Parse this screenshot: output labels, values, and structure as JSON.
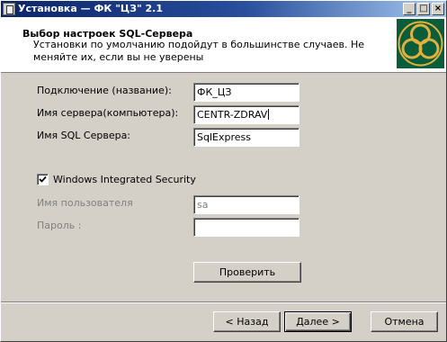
{
  "window": {
    "title": "Установка — ФК \"ЦЗ\" 2.1"
  },
  "titlebar_buttons": {
    "minimize": "_",
    "maximize": "□",
    "close": "×"
  },
  "header": {
    "title": "Выбор настроек SQL-Сервера",
    "subtitle": "Установки по умолчанию подойдут в большинстве случаев. Не меняйте их, если вы не уверены"
  },
  "form": {
    "connection_label": "Подключение (название):",
    "connection_value": "ФК_ЦЗ",
    "server_label": "Имя сервера(компьютера):",
    "server_value": "CENTR-ZDRAV",
    "sql_label": "Имя SQL Сервера:",
    "sql_value": "SqlExpress",
    "integrated_label": "Windows Integrated Security",
    "integrated_checked": true,
    "user_label": "Имя пользователя",
    "user_value": "sa",
    "password_label": "Пароль :",
    "password_value": ""
  },
  "buttons": {
    "check": "Проверить",
    "back": "< Назад",
    "next": "Далее >",
    "cancel": "Отмена"
  },
  "colors": {
    "titlebar": "#0a246a",
    "face": "#d4d0c8",
    "logo": "#0a5d3b",
    "logo_ring": "#e2b03c"
  }
}
